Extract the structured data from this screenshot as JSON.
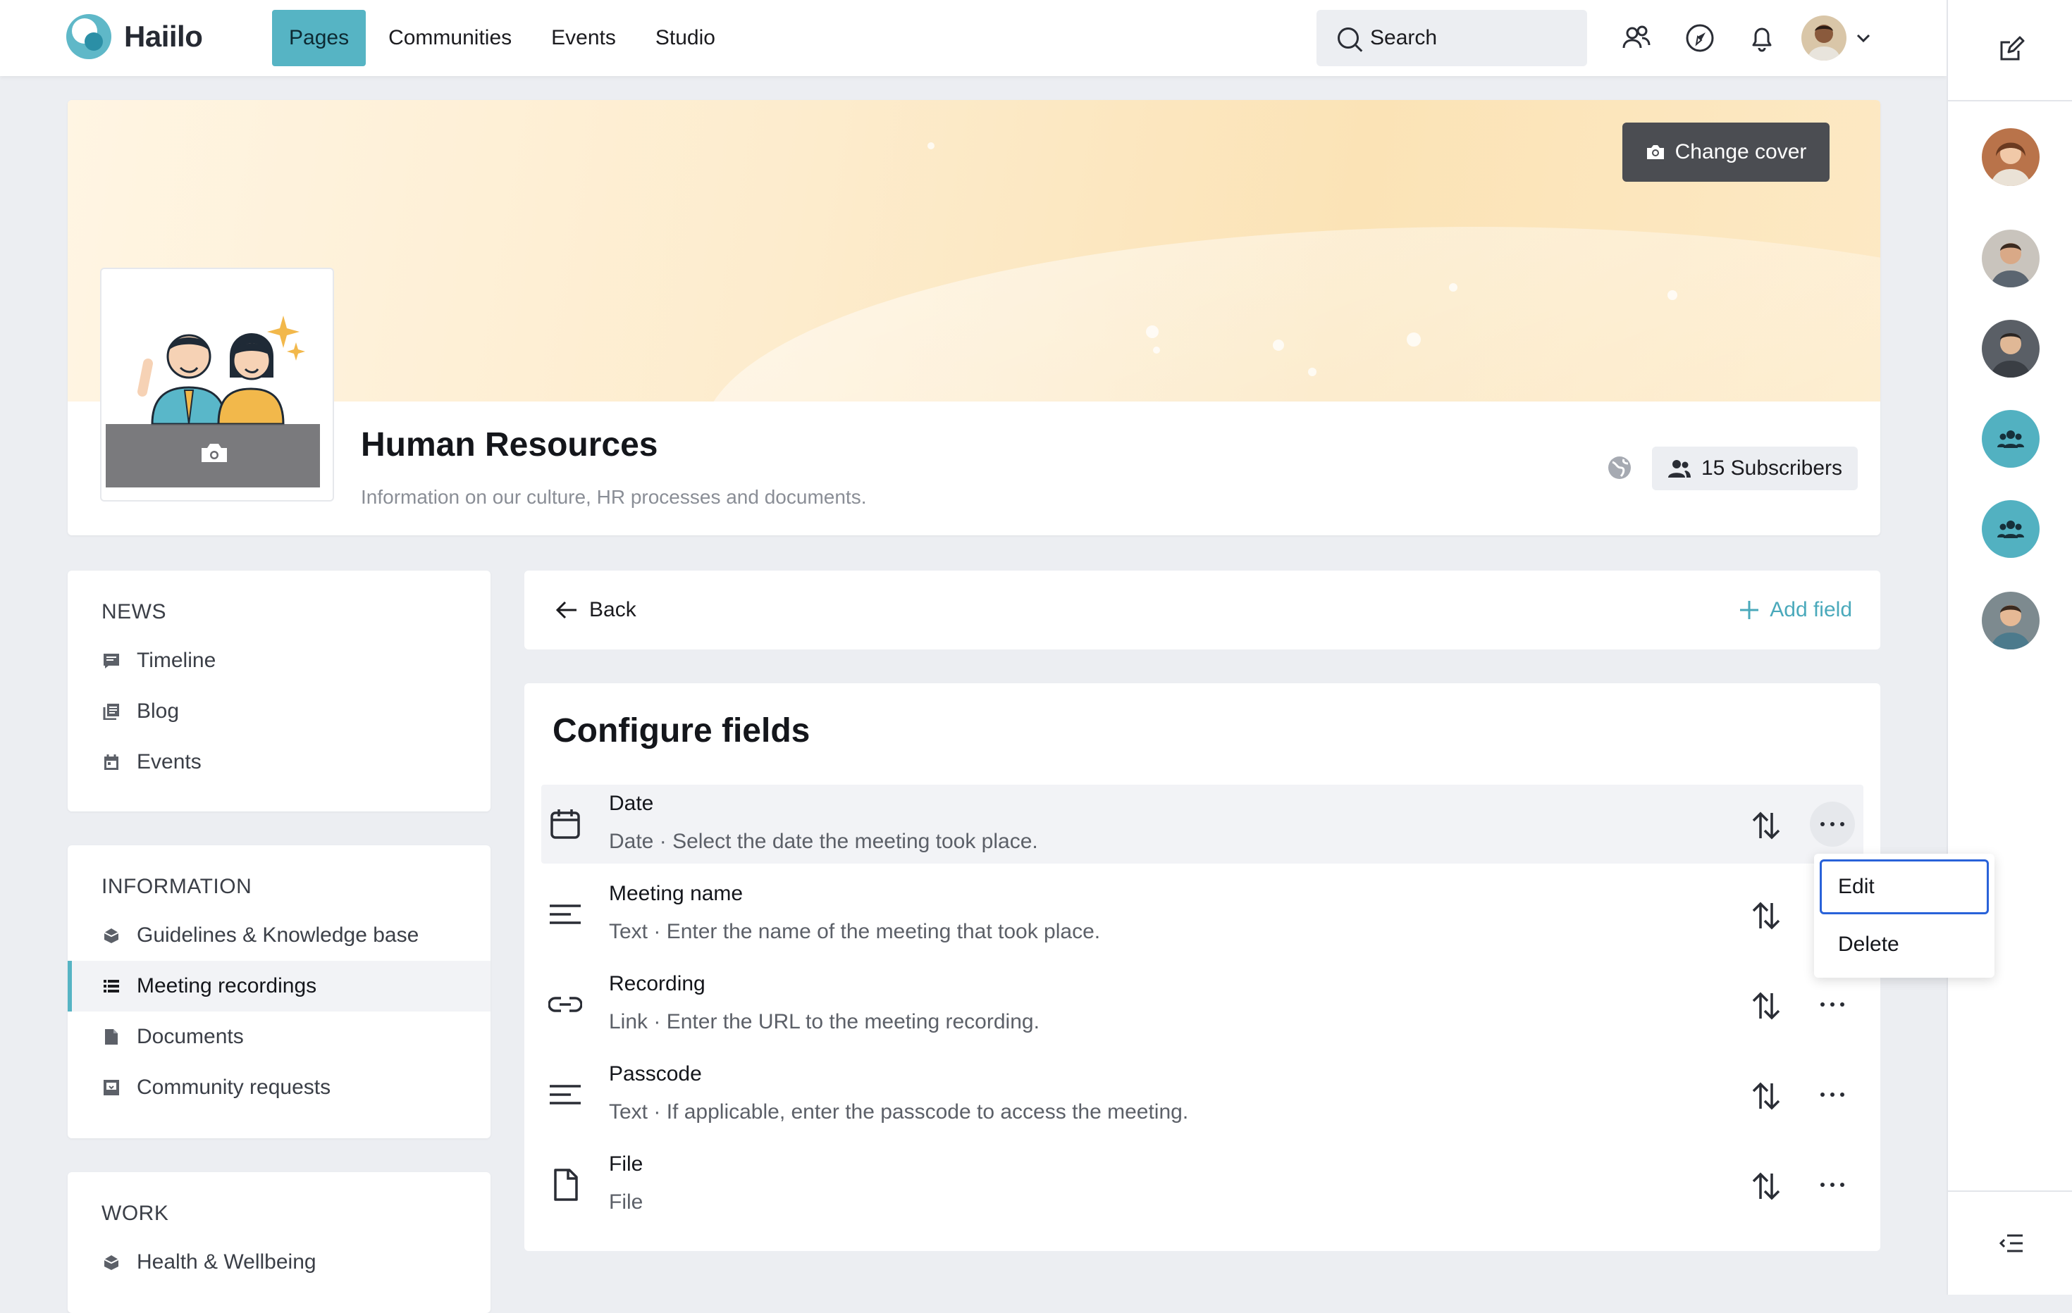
{
  "app": {
    "name": "Haiilo"
  },
  "nav": {
    "items": [
      "Pages",
      "Communities",
      "Events",
      "Studio"
    ],
    "active_index": 0
  },
  "search": {
    "label": "Search"
  },
  "header": {
    "change_cover": "Change cover",
    "title": "Human Resources",
    "description": "Information on our culture, HR processes and documents.",
    "subscribers": "15 Subscribers"
  },
  "sidebar": {
    "sections": [
      {
        "heading": "NEWS",
        "items": [
          "Timeline",
          "Blog",
          "Events"
        ]
      },
      {
        "heading": "INFORMATION",
        "items": [
          "Guidelines & Knowledge base",
          "Meeting recordings",
          "Documents",
          "Community requests"
        ]
      },
      {
        "heading": "WORK",
        "items": [
          "Health & Wellbeing"
        ]
      }
    ],
    "active_item": "Meeting recordings"
  },
  "toolbar": {
    "back": "Back",
    "add_field": "Add field"
  },
  "fields": {
    "title": "Configure fields",
    "rows": [
      {
        "name": "Date",
        "type": "Date",
        "separator": "·",
        "description": "Select the date the meeting took place.",
        "icon": "calendar-icon"
      },
      {
        "name": "Meeting name",
        "type": "Text",
        "separator": "·",
        "description": "Enter the name of the meeting that took place.",
        "icon": "text-lines-icon"
      },
      {
        "name": "Recording",
        "type": "Link",
        "separator": "·",
        "description": "Enter the URL to the meeting recording.",
        "icon": "link-icon"
      },
      {
        "name": "Passcode",
        "type": "Text",
        "separator": "·",
        "description": "If applicable, enter the passcode to access the meeting.",
        "icon": "text-lines-icon"
      },
      {
        "name": "File",
        "type": "File",
        "separator": "",
        "description": "",
        "icon": "file-icon"
      }
    ]
  },
  "context_menu": {
    "items": [
      "Edit",
      "Delete"
    ],
    "focused_index": 0
  },
  "colors": {
    "accent": "#56b4c4",
    "link": "#4aa9bb",
    "focus": "#2962d9"
  }
}
